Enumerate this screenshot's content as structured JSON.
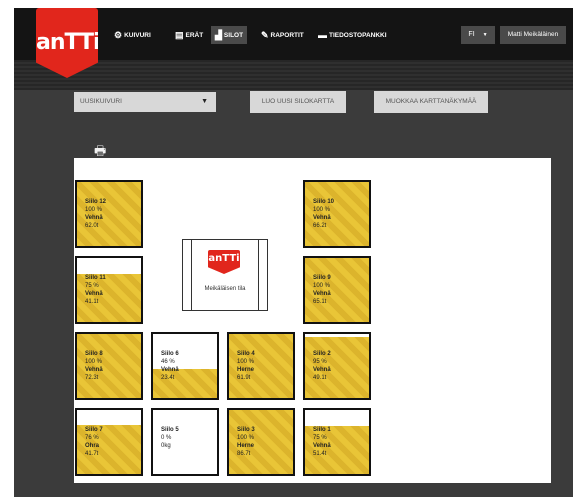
{
  "header": {
    "logo_text": "anTTi",
    "nav": [
      {
        "label": "KUIVURI",
        "icon": "gears-icon"
      },
      {
        "label": "ERÄT",
        "icon": "document-icon"
      },
      {
        "label": "SILOT",
        "icon": "bar-chart-icon",
        "active": true
      },
      {
        "label": "RAPORTIT",
        "icon": "pencil-icon"
      },
      {
        "label": "TIEDOSTOPANKKI",
        "icon": "folder-icon"
      }
    ],
    "language": "FI",
    "user": "Matti Meikäläinen"
  },
  "toolbar": {
    "dryer_select": "UUSIKUIVURI",
    "new_map_button": "LUO UUSI SILOKARTTA",
    "edit_map_button": "MUOKKAA KARTTANÄKYMÄÄ"
  },
  "farm": {
    "name": "Meikäläisen tila",
    "logo_text": "anTTi"
  },
  "colors": {
    "brand_red": "#e1261c",
    "grain_yellow": "#e9c537",
    "header_bg": "#141414"
  },
  "silos": [
    {
      "id": "silo-12",
      "name": "Siilo 12",
      "percent": "100 %",
      "fill": 1.0,
      "crop": "Vehnä",
      "amount": "62.0t"
    },
    {
      "id": "silo-10",
      "name": "Siilo 10",
      "percent": "100 %",
      "fill": 1.0,
      "crop": "Vehnä",
      "amount": "66.2t"
    },
    {
      "id": "silo-11",
      "name": "Siilo 11",
      "percent": "75 %",
      "fill": 0.75,
      "crop": "Vehnä",
      "amount": "41.1t"
    },
    {
      "id": "silo-9",
      "name": "Siilo 9",
      "percent": "100 %",
      "fill": 1.0,
      "crop": "Vehnä",
      "amount": "65.1t"
    },
    {
      "id": "silo-8",
      "name": "Siilo 8",
      "percent": "100 %",
      "fill": 1.0,
      "crop": "Vehnä",
      "amount": "72.3t"
    },
    {
      "id": "silo-6",
      "name": "Siilo 6",
      "percent": "46 %",
      "fill": 0.46,
      "crop": "Vehnä",
      "amount": "23.4t"
    },
    {
      "id": "silo-4",
      "name": "Siilo 4",
      "percent": "100 %",
      "fill": 1.0,
      "crop": "Herne",
      "amount": "61.9t"
    },
    {
      "id": "silo-2",
      "name": "Siilo 2",
      "percent": "95 %",
      "fill": 0.95,
      "crop": "Vehnä",
      "amount": "49.1t"
    },
    {
      "id": "silo-7",
      "name": "Siilo 7",
      "percent": "76 %",
      "fill": 0.76,
      "crop": "Ohra",
      "amount": "41.7t"
    },
    {
      "id": "silo-5",
      "name": "Siilo 5",
      "percent": "0 %",
      "fill": 0.0,
      "crop": "",
      "amount": "0kg"
    },
    {
      "id": "silo-3",
      "name": "Siilo 3",
      "percent": "100 %",
      "fill": 1.0,
      "crop": "Herne",
      "amount": "86.7t"
    },
    {
      "id": "silo-1",
      "name": "Siilo 1",
      "percent": "75 %",
      "fill": 0.75,
      "crop": "Vehnä",
      "amount": "51.4t"
    }
  ]
}
